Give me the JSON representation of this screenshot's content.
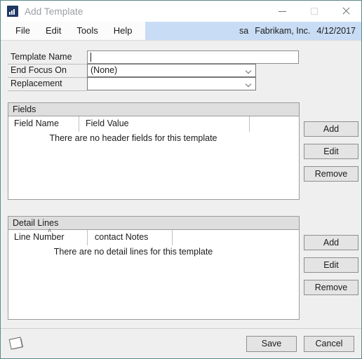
{
  "window": {
    "title": "Add Template",
    "icon": "chart-app-icon",
    "controls": {
      "minimize": "minimize-icon",
      "maximize": "maximize-icon",
      "close": "close-icon"
    }
  },
  "menubar": {
    "items": [
      {
        "label": "File"
      },
      {
        "label": "Edit"
      },
      {
        "label": "Tools"
      },
      {
        "label": "Help"
      }
    ],
    "status": {
      "user": "sa",
      "company": "Fabrikam, Inc.",
      "date": "4/12/2017"
    }
  },
  "form": {
    "template_name": {
      "label": "Template Name",
      "value": "",
      "placeholder": ""
    },
    "end_focus_on": {
      "label": "End Focus On",
      "value": "(None)"
    },
    "replacement": {
      "label": "Replacement",
      "value": ""
    }
  },
  "fields_group": {
    "caption": "Fields",
    "columns": [
      {
        "label": "Field Name"
      },
      {
        "label": "Field Value"
      }
    ],
    "empty_message": "There are no header fields for this template",
    "rows": [],
    "buttons": [
      {
        "label": "Add"
      },
      {
        "label": "Edit"
      },
      {
        "label": "Remove"
      }
    ]
  },
  "detail_group": {
    "caption": "Detail Lines",
    "columns": [
      {
        "label": "Line Number",
        "sorted": true,
        "sort_glyph": "˄"
      },
      {
        "label": "contact Notes"
      }
    ],
    "empty_message": "There are no detail lines for this template",
    "rows": [],
    "buttons": [
      {
        "label": "Add"
      },
      {
        "label": "Edit"
      },
      {
        "label": "Remove"
      }
    ]
  },
  "bottombar": {
    "note_icon": "note-icon",
    "save_label": "Save",
    "cancel_label": "Cancel"
  },
  "colors": {
    "window_border": "#5a8a8c",
    "menubar_accent": "#c9dcf5",
    "app_background": "#efefef",
    "title_text": "#9aa0a6",
    "group_caption_bg": "#dedede",
    "button_face": "#e4e4e4"
  }
}
